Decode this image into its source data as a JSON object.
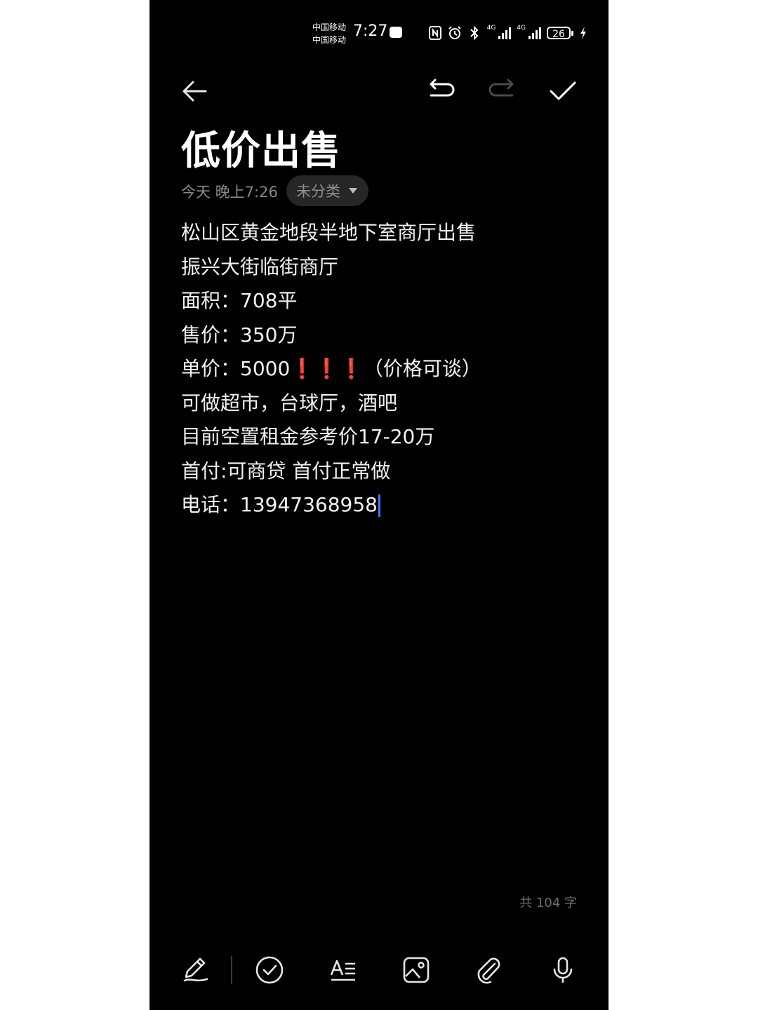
{
  "status_bar": {
    "carrier_1": "中国移动",
    "carrier_2": "中国移动",
    "time": "7:27",
    "network_1": "4G",
    "network_2": "4G",
    "battery": "26",
    "icons": [
      "nfc-icon",
      "alarm-icon",
      "bluetooth-icon",
      "signal-icon",
      "signal-icon",
      "battery-icon",
      "charging-icon"
    ]
  },
  "toolbar": {
    "back": "back-arrow-icon",
    "undo": "undo-icon",
    "redo": "redo-icon",
    "done": "checkmark-icon"
  },
  "note": {
    "title": "低价出售",
    "timestamp": "今天 晚上7:26",
    "category": "未分类",
    "lines": [
      "松山区黄金地段半地下室商厅出售",
      "振兴大街临街商厅",
      "面积：708平",
      "售价：350万",
      "单价：5000",
      "❗❗❗",
      "（价格可谈）",
      "可做超市，台球厅，酒吧",
      "目前空置租金参考价17-20万",
      "首付:可商贷 首付正常做",
      "电话：13947368958"
    ]
  },
  "word_count": "共 104 字",
  "bottom_bar": {
    "items": [
      "handwriting-pen-icon",
      "checklist-icon",
      "text-format-icon",
      "image-icon",
      "attachment-icon",
      "microphone-icon"
    ]
  },
  "colors": {
    "background": "#000000",
    "text": "#f2f2f2",
    "muted": "#8a8a8a",
    "cursor": "#3d7bff",
    "exclamation": "#e53935"
  }
}
